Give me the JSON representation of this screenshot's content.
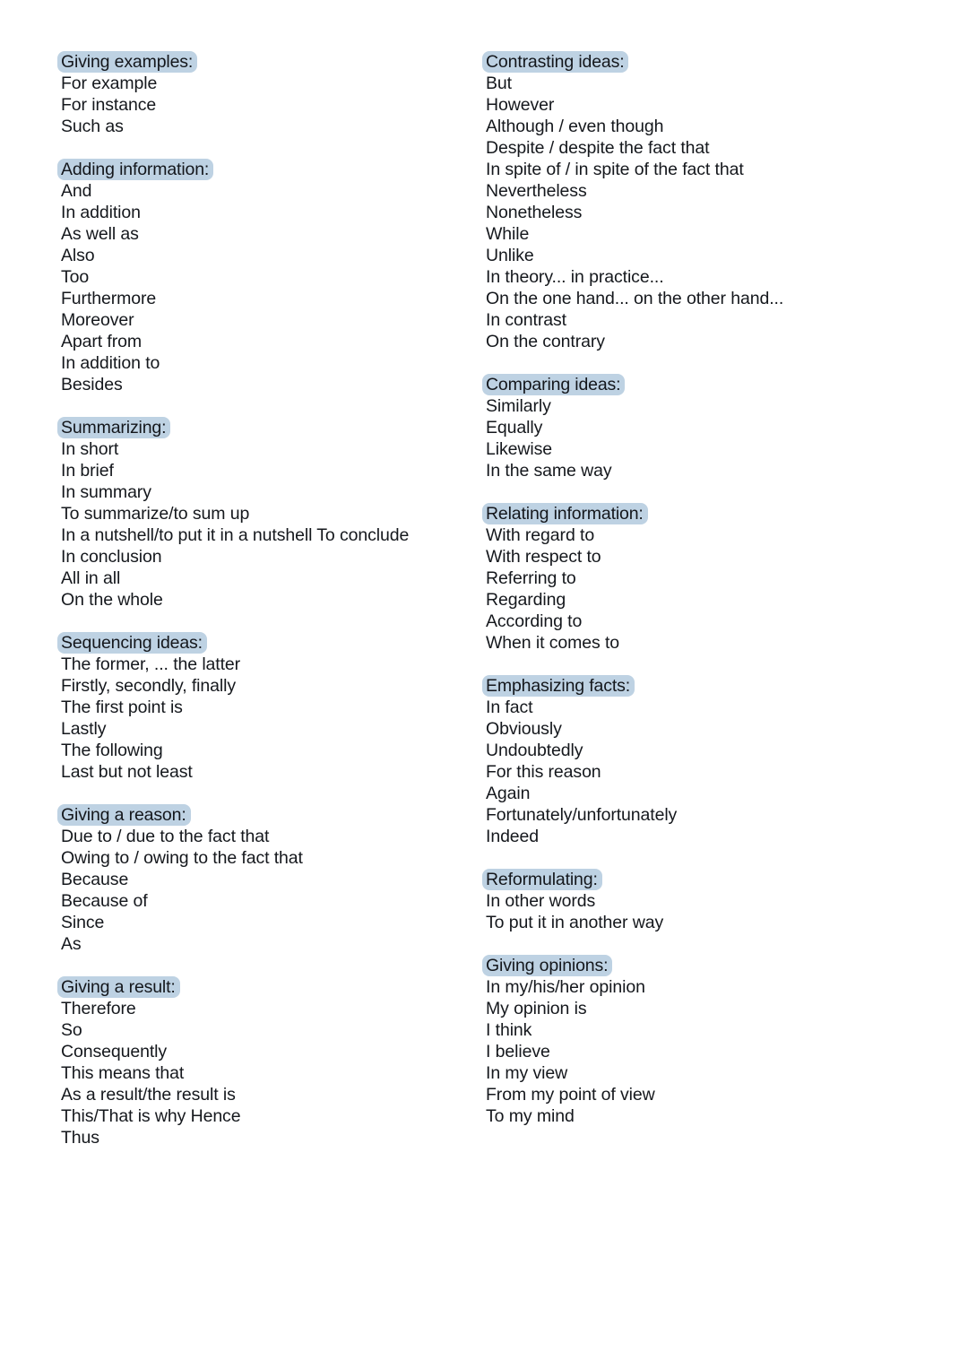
{
  "document": {
    "background_color": "#ffffff",
    "text_color": "#15181d",
    "highlight_color": "#bed2e3"
  },
  "columns": [
    {
      "name": "left-column",
      "sections": [
        {
          "heading": "Giving examples:",
          "items": [
            "For example",
            "For instance",
            "Such as"
          ]
        },
        {
          "heading": "Adding information:",
          "items": [
            "And",
            "In addition",
            "As well as",
            "Also",
            "Too",
            "Furthermore",
            "Moreover",
            "Apart from",
            "In addition to",
            "Besides"
          ]
        },
        {
          "heading": "Summarizing:",
          "items": [
            "In short",
            "In brief",
            "In summary",
            "To summarize/to sum up",
            "In a nutshell/to put it in a nutshell To conclude",
            "In conclusion",
            "All in all",
            "On the whole"
          ]
        },
        {
          "heading": "Sequencing ideas:",
          "items": [
            "The former, ... the latter",
            "Firstly, secondly, finally",
            "The first point is",
            "Lastly",
            "The following",
            "Last but not least"
          ]
        },
        {
          "heading": "Giving a reason:",
          "items": [
            "Due to / due to the fact that",
            "Owing to / owing to the fact that",
            "Because",
            "Because of",
            "Since",
            "As"
          ]
        },
        {
          "heading": "Giving a result:",
          "items": [
            "Therefore",
            "So",
            "Consequently",
            "This means that",
            "As a result/the result is",
            "This/That is why Hence",
            "Thus"
          ]
        }
      ]
    },
    {
      "name": "right-column",
      "sections": [
        {
          "heading": "Contrasting ideas:",
          "items": [
            "But",
            "However",
            "Although / even though",
            "Despite / despite the fact that",
            "In spite of / in spite of the fact that",
            "Nevertheless",
            "Nonetheless",
            "While",
            "Unlike",
            "In theory... in practice...",
            "On the one hand... on the other hand...",
            "In contrast",
            "On the contrary"
          ]
        },
        {
          "heading": "Comparing ideas:",
          "items": [
            "Similarly",
            "Equally",
            "Likewise",
            "In the same way"
          ]
        },
        {
          "heading": "Relating information:",
          "items": [
            "With regard to",
            "With respect to",
            "Referring to",
            "Regarding",
            "According to",
            "When it comes to"
          ]
        },
        {
          "heading": "Emphasizing facts:",
          "items": [
            "In fact",
            "Obviously",
            "Undoubtedly",
            "For this reason",
            "Again",
            "Fortunately/unfortunately",
            "Indeed"
          ]
        },
        {
          "heading": "Reformulating:",
          "items": [
            "In other words",
            "To put it in another way"
          ]
        },
        {
          "heading": "Giving opinions:",
          "items": [
            "In my/his/her opinion",
            "My opinion is",
            "I think",
            "I believe",
            "In my view",
            "From my point of view",
            "To my mind"
          ]
        }
      ]
    }
  ]
}
